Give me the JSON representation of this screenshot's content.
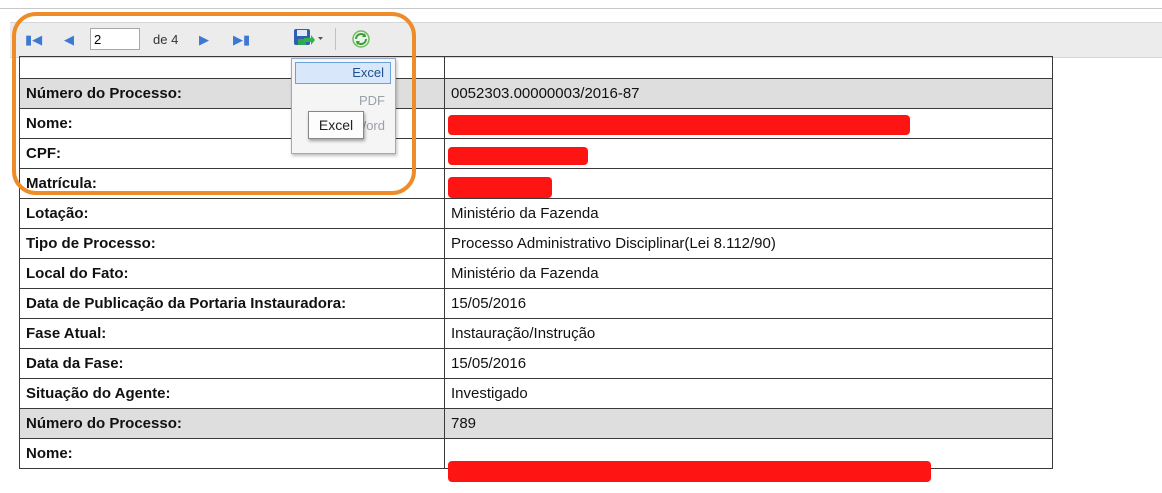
{
  "pager": {
    "current_page": "2",
    "total_label": "de 4"
  },
  "export_menu": {
    "items": [
      "Excel",
      "PDF",
      "Word"
    ],
    "tooltip": "Excel"
  },
  "rows": [
    {
      "label": "",
      "value": "",
      "shaded": false
    },
    {
      "label": "Número do Processo:",
      "value": "0052303.00000003/2016-87",
      "shaded": true
    },
    {
      "label": "Nome:",
      "value": "",
      "shaded": false
    },
    {
      "label": "CPF:",
      "value": "",
      "shaded": false
    },
    {
      "label": "Matrícula:",
      "value": "",
      "shaded": false
    },
    {
      "label": "Lotação:",
      "value": "Ministério da Fazenda",
      "shaded": false
    },
    {
      "label": "Tipo de Processo:",
      "value": "Processo Administrativo Disciplinar(Lei 8.112/90)",
      "shaded": false
    },
    {
      "label": "Local do Fato:",
      "value": "Ministério da Fazenda",
      "shaded": false
    },
    {
      "label": "Data de Publicação da Portaria Instauradora:",
      "value": "15/05/2016",
      "shaded": false
    },
    {
      "label": "Fase Atual:",
      "value": "Instauração/Instrução",
      "shaded": false
    },
    {
      "label": "Data da Fase:",
      "value": "15/05/2016",
      "shaded": false
    },
    {
      "label": "Situação do Agente:",
      "value": "Investigado",
      "shaded": false
    },
    {
      "label": "Número do Processo:",
      "value": "789",
      "shaded": true
    },
    {
      "label": "Nome:",
      "value": "",
      "shaded": false
    }
  ],
  "colors": {
    "highlight": "#ee8c2a",
    "redaction": "#ff1414",
    "shaded_row": "#dedede",
    "nav_icon": "#3d79d4"
  }
}
